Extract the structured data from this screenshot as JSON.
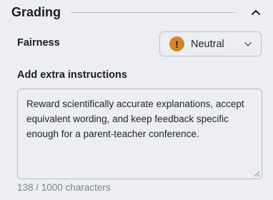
{
  "section": {
    "title": "Grading",
    "collapse_icon": "chevron-up-icon"
  },
  "fairness": {
    "label": "Fairness",
    "selected_value": "Neutral",
    "status_icon": "warning-icon",
    "status_glyph": "!",
    "status_color": "#d3852a",
    "dropdown_icon": "chevron-down-icon"
  },
  "instructions": {
    "label": "Add extra instructions",
    "value": "Reward scientifically accurate explanations, accept equivalent wording, and keep feedback specific enough for a parent-teacher conference.",
    "counter": "138 / 1000 characters"
  }
}
